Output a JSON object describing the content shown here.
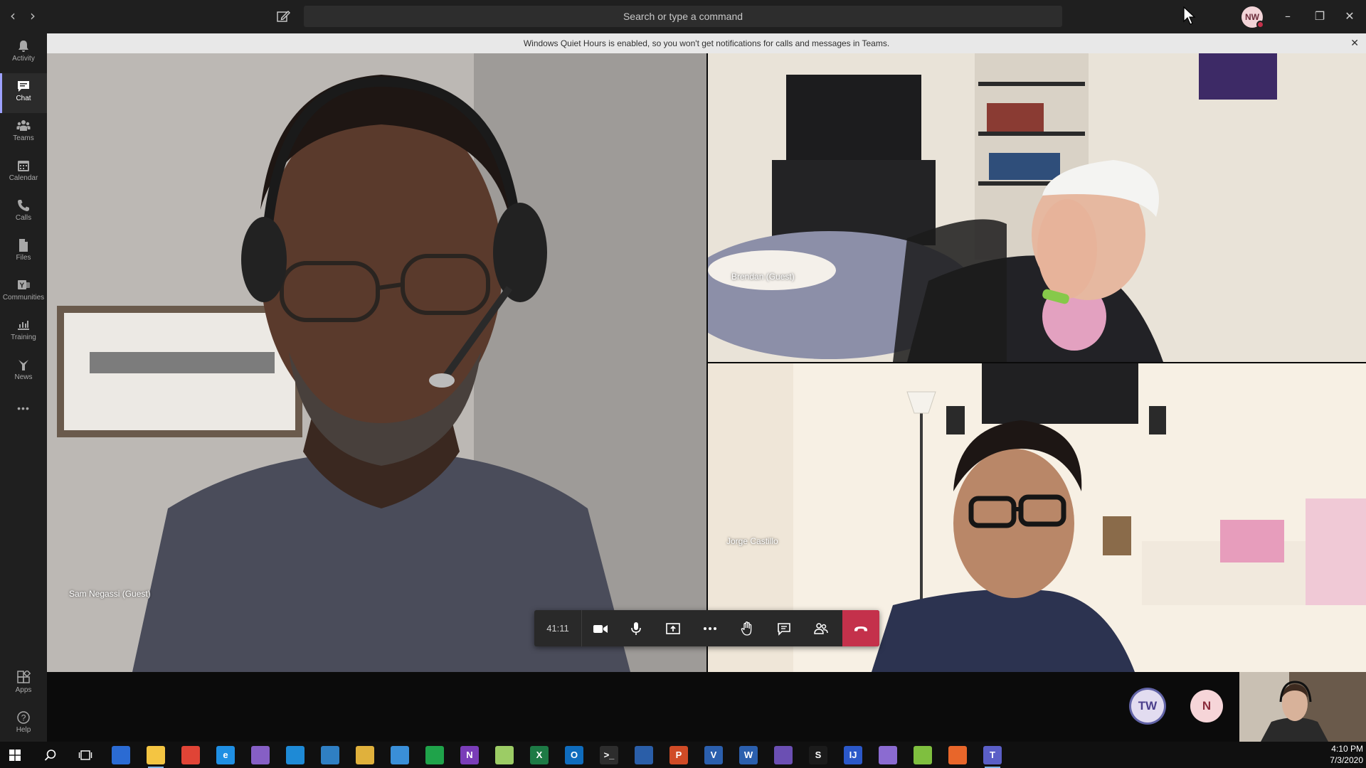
{
  "titlebar": {
    "search_placeholder": "Search or type a command",
    "avatar_initials": "NW",
    "nav_back": "‹",
    "nav_forward": "›",
    "minimize": "–",
    "restore": "❐",
    "close": "✕"
  },
  "rail": {
    "items": [
      {
        "label": "Activity",
        "icon": "bell-icon"
      },
      {
        "label": "Chat",
        "icon": "chat-icon",
        "active": true
      },
      {
        "label": "Teams",
        "icon": "teams-icon"
      },
      {
        "label": "Calendar",
        "icon": "calendar-icon"
      },
      {
        "label": "Calls",
        "icon": "phone-icon"
      },
      {
        "label": "Files",
        "icon": "file-icon"
      },
      {
        "label": "Communities",
        "icon": "communities-icon"
      },
      {
        "label": "Training",
        "icon": "training-icon"
      },
      {
        "label": "News",
        "icon": "news-icon"
      }
    ],
    "more": "•••",
    "bottom": [
      {
        "label": "Apps",
        "icon": "apps-icon"
      },
      {
        "label": "Help",
        "icon": "help-icon"
      }
    ]
  },
  "banner": {
    "text": "Windows Quiet Hours is enabled, so you won't get notifications for calls and messages in Teams.",
    "close": "✕"
  },
  "participants": {
    "sam": "Sam Negassi (Guest)",
    "brendan": "Brendan (Guest)",
    "jorge": "Jorge Castillo"
  },
  "call": {
    "timer": "41:11"
  },
  "strip": {
    "avatars": [
      "TW",
      "N"
    ]
  },
  "taskbar": {
    "time": "4:10 PM",
    "date": "7/3/2020",
    "apps": [
      {
        "name": "outlook-tasks",
        "color": "#2b6bd3",
        "letter": ""
      },
      {
        "name": "file-explorer",
        "color": "#f4c542",
        "letter": ""
      },
      {
        "name": "chrome",
        "color": "#e04436",
        "letter": ""
      },
      {
        "name": "internet-explorer",
        "color": "#1f8fe3",
        "letter": "e"
      },
      {
        "name": "visual-studio",
        "color": "#865fc5",
        "letter": ""
      },
      {
        "name": "vs-code",
        "color": "#1e8ad6",
        "letter": ""
      },
      {
        "name": "powershell-ise",
        "color": "#2f7fc3",
        "letter": ""
      },
      {
        "name": "paint-tool",
        "color": "#e0b13c",
        "letter": ""
      },
      {
        "name": "network-tool",
        "color": "#3a8fd8",
        "letter": ""
      },
      {
        "name": "git-tool",
        "color": "#1fa34a",
        "letter": ""
      },
      {
        "name": "onenote",
        "color": "#7a3db8",
        "letter": "N"
      },
      {
        "name": "notepad-plus",
        "color": "#9ccc65",
        "letter": ""
      },
      {
        "name": "excel",
        "color": "#1d7a45",
        "letter": "X"
      },
      {
        "name": "outlook",
        "color": "#0f6cbd",
        "letter": "O"
      },
      {
        "name": "terminal",
        "color": "#2d2d2d",
        "letter": ">_"
      },
      {
        "name": "powershell",
        "color": "#2a5ea8",
        "letter": ""
      },
      {
        "name": "powerpoint",
        "color": "#d04b26",
        "letter": "P"
      },
      {
        "name": "visio",
        "color": "#2b5fad",
        "letter": "V"
      },
      {
        "name": "word",
        "color": "#2b5fad",
        "letter": "W"
      },
      {
        "name": "visual-studio-2",
        "color": "#6b4fb3",
        "letter": ""
      },
      {
        "name": "sourcetree",
        "color": "#1b1b1b",
        "letter": "S"
      },
      {
        "name": "intellij",
        "color": "#2b58c9",
        "letter": "IJ"
      },
      {
        "name": "screen-tool",
        "color": "#8b6bd1",
        "letter": ""
      },
      {
        "name": "chart-tool",
        "color": "#7fbf3f",
        "letter": ""
      },
      {
        "name": "firefox",
        "color": "#e8662a",
        "letter": ""
      },
      {
        "name": "teams",
        "color": "#5b5fc7",
        "letter": "T"
      }
    ]
  }
}
